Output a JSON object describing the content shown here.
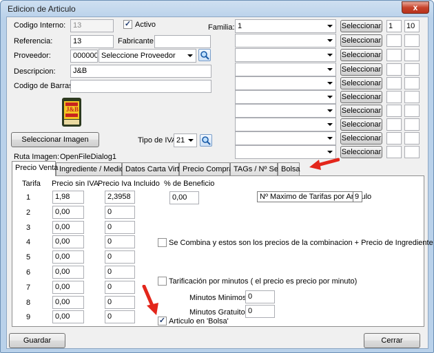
{
  "window": {
    "title": "Edicion de Articulo",
    "close_glyph": "x"
  },
  "form": {
    "codigo_interno": {
      "label": "Codigo Interno:",
      "value": "13"
    },
    "activo": {
      "label": "Activo",
      "checked": true
    },
    "referencia": {
      "label": "Referencia:",
      "value": "13"
    },
    "fabricante": {
      "label": "Fabricante:",
      "value": ""
    },
    "proveedor": {
      "label": "Proveedor:",
      "code": "000000",
      "select_value": "Seleccione Proveedor"
    },
    "descripcion": {
      "label": "Descripcion:",
      "value": "J&B"
    },
    "codigo_barras": {
      "label": "Codigo de Barras:",
      "value": ""
    },
    "select_image_button": "Seleccionar Imagen",
    "tipo_iva": {
      "label": "Tipo de IVA",
      "value": "21"
    },
    "ruta_imagen": {
      "label": "Ruta Imagen:",
      "value": "OpenFileDialog1"
    },
    "image_logo_text": "J&B"
  },
  "familia": {
    "label": "Familia:",
    "rows": [
      {
        "value": "1",
        "button": "Seleccionar",
        "a": "1",
        "b": "10"
      },
      {
        "value": "",
        "button": "Seleccionar",
        "a": "",
        "b": ""
      },
      {
        "value": "",
        "button": "Seleccionar",
        "a": "",
        "b": ""
      },
      {
        "value": "",
        "button": "Seleccionar",
        "a": "",
        "b": ""
      },
      {
        "value": "",
        "button": "Seleccionar",
        "a": "",
        "b": ""
      },
      {
        "value": "",
        "button": "Seleccionar",
        "a": "",
        "b": ""
      },
      {
        "value": "",
        "button": "Seleccionar",
        "a": "",
        "b": ""
      },
      {
        "value": "",
        "button": "Seleccionar",
        "a": "",
        "b": ""
      },
      {
        "value": "",
        "button": "Seleccionar",
        "a": "",
        "b": ""
      },
      {
        "value": "",
        "button": "Seleccionar",
        "a": "",
        "b": ""
      }
    ]
  },
  "tabs": [
    {
      "label": "Precio Venta",
      "active": true
    },
    {
      "label": "Ingrediente / Medidas",
      "active": false
    },
    {
      "label": "Datos Carta Virtual",
      "active": false
    },
    {
      "label": "Precio Compra",
      "active": false
    },
    {
      "label": "TAGs / Nº Serie",
      "active": false
    },
    {
      "label": "Bolsa",
      "active": false
    }
  ],
  "precio_venta": {
    "headers": {
      "tarifa": "Tarifa",
      "sin_iva": "Precio sin IVA",
      "iva_incluido": "Precio Iva Incluido",
      "beneficio": "% de Beneficio"
    },
    "rows": [
      {
        "tarifa": "1",
        "sin_iva": "1,98",
        "iva_incluido": "2,3958"
      },
      {
        "tarifa": "2",
        "sin_iva": "0,00",
        "iva_incluido": "0"
      },
      {
        "tarifa": "3",
        "sin_iva": "0,00",
        "iva_incluido": "0"
      },
      {
        "tarifa": "4",
        "sin_iva": "0,00",
        "iva_incluido": "0"
      },
      {
        "tarifa": "5",
        "sin_iva": "0,00",
        "iva_incluido": "0"
      },
      {
        "tarifa": "6",
        "sin_iva": "0,00",
        "iva_incluido": "0"
      },
      {
        "tarifa": "7",
        "sin_iva": "0,00",
        "iva_incluido": "0"
      },
      {
        "tarifa": "8",
        "sin_iva": "0,00",
        "iva_incluido": "0"
      },
      {
        "tarifa": "9",
        "sin_iva": "0,00",
        "iva_incluido": "0"
      }
    ],
    "beneficio_value": "0,00",
    "max_tarifas": {
      "label": "Nº Maximo de Tarifas por Articulo",
      "value": "9"
    },
    "se_combina": {
      "label": "Se Combina y estos son los precios de la combinacion + Precio de Ingrediente",
      "checked": false
    },
    "tarificacion": {
      "label": "Tarificación por minutos ( el precio es precio por minuto)",
      "checked": false
    },
    "minutos_minimos": {
      "label": "Minutos Minimos",
      "value": "0"
    },
    "minutos_gratuitos": {
      "label": "Minutos Gratuitos",
      "value": "0"
    },
    "articulo_bolsa": {
      "label": "Articulo en 'Bolsa'",
      "checked": true
    }
  },
  "footer": {
    "guardar": "Guardar",
    "cerrar": "Cerrar"
  },
  "colors": {
    "annotation_arrow": "#e3261b",
    "title_bar": "#b9d1ea"
  }
}
